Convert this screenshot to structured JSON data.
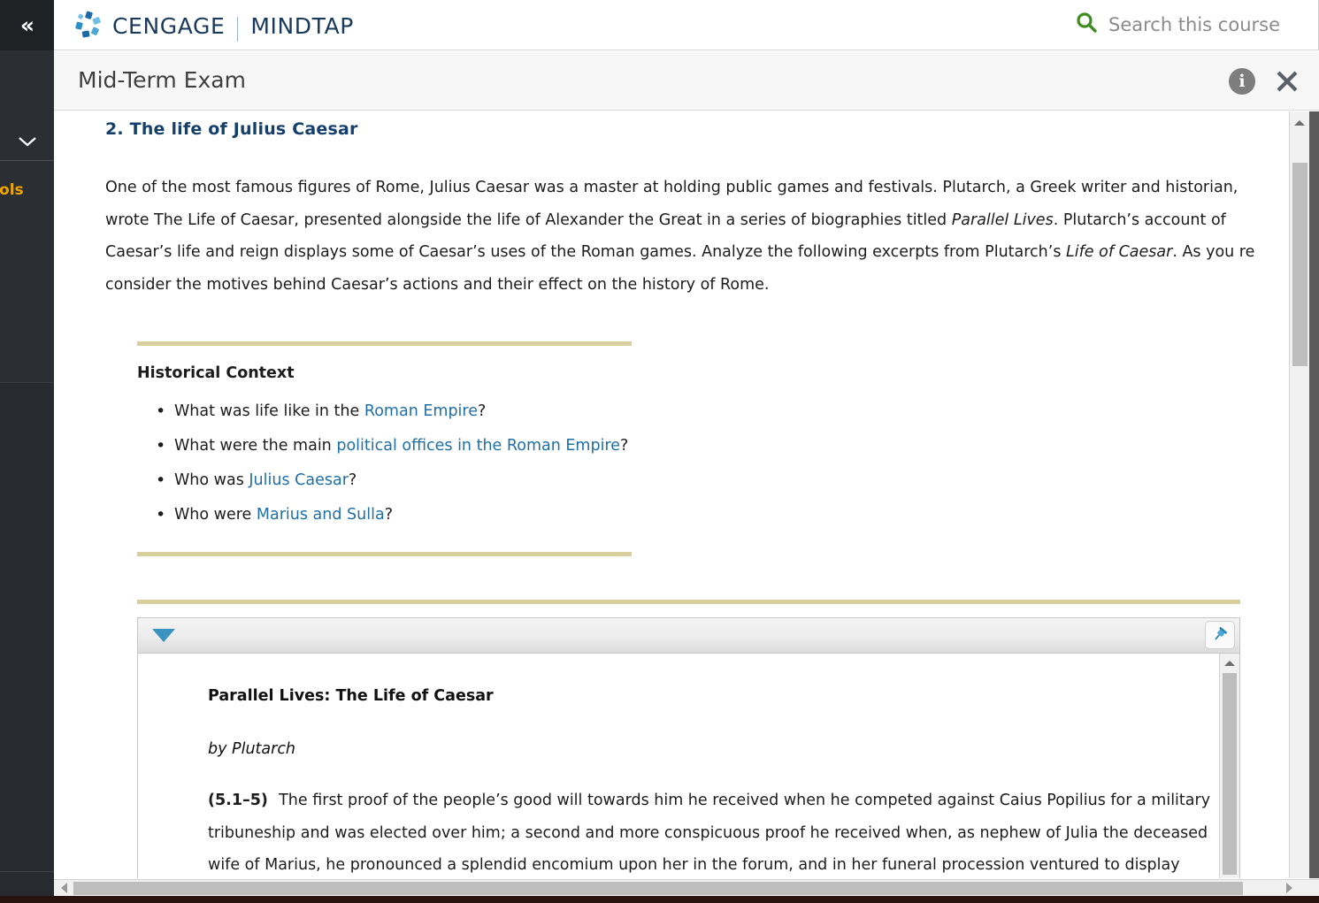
{
  "sidebar": {
    "collapse_icon": "double-chevron-left",
    "chevron_icon": "chevron-down",
    "tools_label": "Tools"
  },
  "header": {
    "brand": "CENGAGE",
    "brand_secondary": "MINDTAP",
    "search_placeholder": "Search this course",
    "search_icon": "search-icon",
    "search_icon_color": "#3f8c20"
  },
  "titlebar": {
    "title": "Mid-Term Exam",
    "info_label": "i",
    "close_label": "✕"
  },
  "question": {
    "heading": "2. The life of Julius Caesar",
    "heading_color": "#15406b",
    "paragraph_lines": [
      [
        {
          "t": "One of the most famous figures of Rome, Julius Caesar was a master at holding public games and festivals. Plutarch, a Greek writer and historian,",
          "i": false
        }
      ],
      [
        {
          "t": "wrote The Life of Caesar, presented alongside the life of Alexander the Great in a series of biographies titled ",
          "i": false
        },
        {
          "t": "Parallel Lives",
          "i": true
        },
        {
          "t": ". Plutarch’s account of",
          "i": false
        }
      ],
      [
        {
          "t": "Caesar’s life and reign displays some of Caesar’s uses of the Roman games. Analyze the following excerpts from Plutarch’s ",
          "i": false
        },
        {
          "t": "Life of Caesar",
          "i": true
        },
        {
          "t": ". As you re",
          "i": false
        }
      ],
      [
        {
          "t": "consider the motives behind Caesar’s actions and their effect on the history of Rome.",
          "i": false
        }
      ]
    ]
  },
  "historical_context": {
    "title": "Historical Context",
    "rule_color": "#d9cf9d",
    "link_color": "#1f6fa8",
    "items": [
      [
        {
          "t": "What was life like in the ",
          "l": false
        },
        {
          "t": "Roman Empire",
          "l": true
        },
        {
          "t": "?",
          "l": false
        }
      ],
      [
        {
          "t": "What were the main ",
          "l": false
        },
        {
          "t": "political offices in the Roman Empire",
          "l": true
        },
        {
          "t": "?",
          "l": false
        }
      ],
      [
        {
          "t": "Who was ",
          "l": false
        },
        {
          "t": "Julius Caesar",
          "l": true
        },
        {
          "t": "?",
          "l": false
        }
      ],
      [
        {
          "t": "Who were ",
          "l": false
        },
        {
          "t": "Marius and Sulla",
          "l": true
        },
        {
          "t": "?",
          "l": false
        }
      ]
    ]
  },
  "excerpt_panel": {
    "toggle_icon": "triangle-down-icon",
    "toggle_color": "#3a93c0",
    "pin_icon": "pushpin-icon",
    "title": "Parallel Lives: The Life of Caesar",
    "author": "by Plutarch",
    "citation": "(5.1–5)",
    "body_lines": [
      "The first proof of the people’s good will towards him he received when he competed against Caius Popilius for a military",
      "tribuneship and was elected over him; a second and more conspicuous proof he received when, as nephew of Julia the deceased",
      "wife of Marius, he pronounced a splendid encomium upon her in the forum, and in her funeral procession ventured to display"
    ]
  },
  "scrollbars": {
    "up_arrow": "arrow-up-icon",
    "left_arrow": "arrow-left-icon",
    "right_arrow": "arrow-right-icon"
  }
}
